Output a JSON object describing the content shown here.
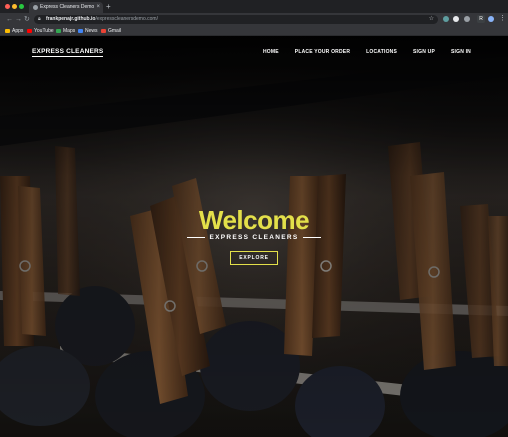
{
  "browser": {
    "tab_title": "Express Cleaners Demo",
    "tab_close": "×",
    "new_tab": "+",
    "url_host": "frankpenajr.github.io",
    "url_path": "/expresscleanersdemo.com/",
    "ext_badge": "R",
    "bookmarks": [
      {
        "label": "Apps"
      },
      {
        "label": "YouTube"
      },
      {
        "label": "Maps"
      },
      {
        "label": "News"
      },
      {
        "label": "Gmail"
      }
    ]
  },
  "site": {
    "brand": "EXPRESS CLEANERS",
    "nav": [
      "HOME",
      "PLACE YOUR ORDER",
      "LOCATIONS",
      "SIGN UP",
      "SIGN IN"
    ],
    "hero": {
      "title": "Welcome",
      "subtitle": "EXPRESS CLEANERS",
      "button": "EXPLORE"
    },
    "colors": {
      "accent": "#e3e04a",
      "text": "#ffffff"
    }
  }
}
